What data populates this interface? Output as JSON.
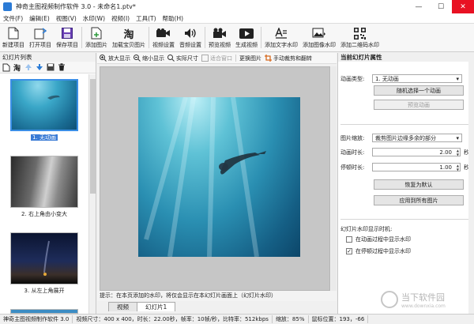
{
  "window": {
    "title": "神奇主图视频制作软件 3.0 - 未命名1.ptv*",
    "min": "—",
    "max": "☐",
    "close": "✕"
  },
  "menu": [
    "文件(F)",
    "编辑(E)",
    "视图(V)",
    "水印(W)",
    "视频(I)",
    "工具(T)",
    "帮助(H)"
  ],
  "toolbar": [
    {
      "label": "新建项目",
      "icon": "new-project-icon"
    },
    {
      "label": "打开项目",
      "icon": "open-project-icon"
    },
    {
      "label": "保存项目",
      "icon": "save-project-icon"
    },
    {
      "label": "添加图片",
      "icon": "add-image-icon"
    },
    {
      "label": "加载宝贝图片",
      "icon": "taobao-icon",
      "glyph": "淘"
    },
    {
      "label": "视频设置",
      "icon": "video-camera-icon"
    },
    {
      "label": "音频设置",
      "icon": "audio-icon"
    },
    {
      "label": "预览视频",
      "icon": "preview-camera-icon"
    },
    {
      "label": "生成视频",
      "icon": "generate-video-icon"
    },
    {
      "label": "添加文字水印",
      "icon": "text-watermark-icon"
    },
    {
      "label": "添加图像水印",
      "icon": "image-watermark-icon"
    },
    {
      "label": "添加二维码水印",
      "icon": "qrcode-icon"
    }
  ],
  "left": {
    "title": "幻灯片列表",
    "slides": [
      {
        "caption": "1. 无动画",
        "selected": true
      },
      {
        "caption": "2. 右上角由小变大",
        "selected": false
      },
      {
        "caption": "3. 从左上角展开",
        "selected": false
      }
    ]
  },
  "preview_tools": {
    "zoom_in": "放大显示",
    "zoom_out": "缩小显示",
    "actual": "实际尺寸",
    "fit": "适合窗口",
    "replace": "更换图片",
    "crop_rotate": "手动裁剪和翻转"
  },
  "hint": "提示：在本页添加的水印，将仅会显示在本幻灯片画面上（幻灯片水印）",
  "tabs": [
    "视频",
    "幻灯片1"
  ],
  "right": {
    "title": "当前幻灯片属性",
    "anim_type_label": "动画类型:",
    "anim_type_value": "1. 无动画",
    "random_anim_btn": "随机选择一个动画",
    "preview_anim_btn": "预览动画",
    "scale_label": "图片缩放:",
    "scale_value": "裁剪图片边缘多余的部分",
    "anim_dur_label": "动画时长:",
    "anim_dur_value": "2.00",
    "stop_dur_label": "停顿时长:",
    "stop_dur_value": "1.00",
    "unit_sec": "秒",
    "restore_btn": "恢复为默认",
    "apply_all_btn": "应用到所有图片",
    "watermark_when_label": "幻灯片水印显示时机:",
    "wm_during_anim": "在动画过程中显示水印",
    "wm_during_anim_checked": false,
    "wm_during_stop": "在停顿过程中显示水印",
    "wm_during_stop_checked": true
  },
  "status": {
    "app": "神奇主图视频制作软件 3.0",
    "info": "视频尺寸：400 x 400，时长：22.00秒，帧率：10帧/秒，比特率：512kbps",
    "zoom": "缩放：85%",
    "coords": "鼠标位置：193，-66"
  },
  "watermark": {
    "cn": "当下软件园",
    "en": "www.downxia.com"
  },
  "colors": {
    "accent": "#3a7bd5",
    "underwater_deep": "#0a4a66",
    "underwater_light": "#4fb3c9"
  }
}
